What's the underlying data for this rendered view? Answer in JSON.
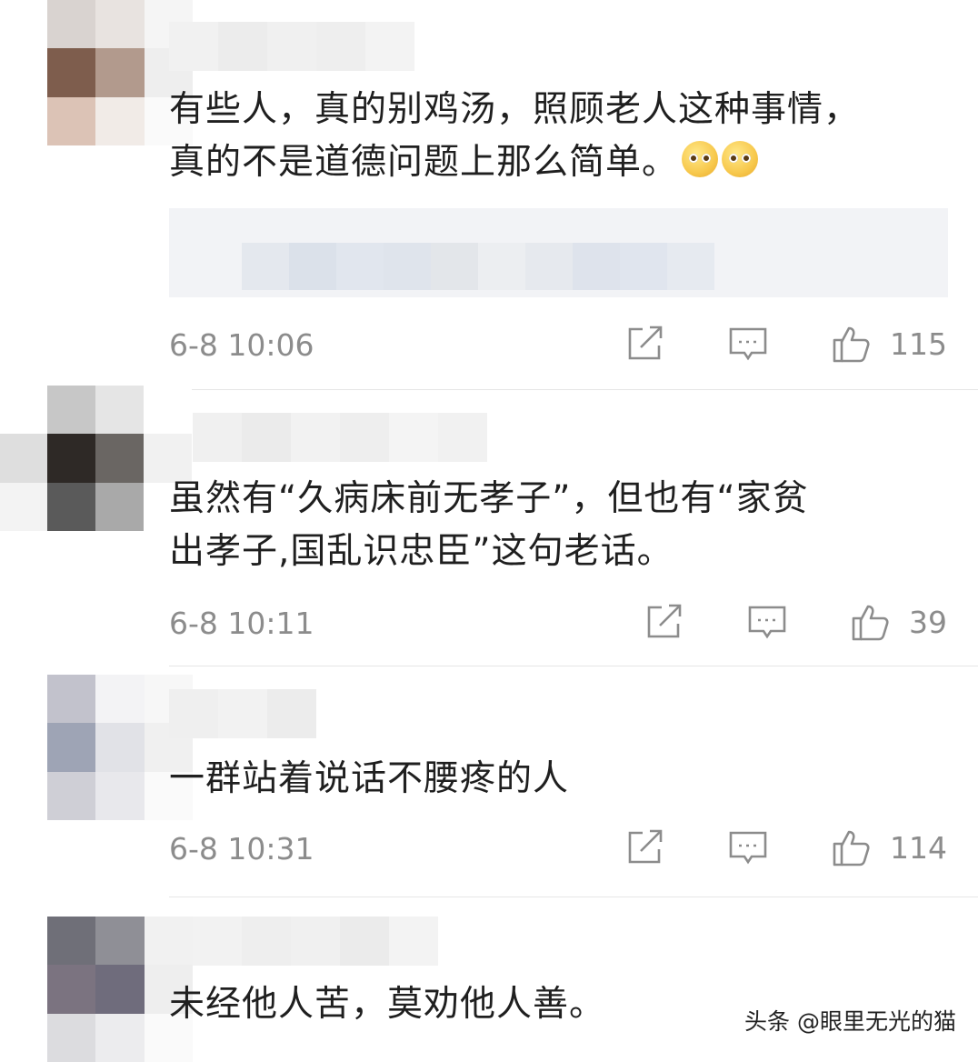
{
  "comments": [
    {
      "text_line1": "有些人，真的别鸡汤，照顾老人这种事情，",
      "text_line2": "真的不是道德问题上那么简单。",
      "emoji": [
        "pleading-face-emoji",
        "pleading-face-emoji"
      ],
      "time": "6-8 10:06",
      "likes": "115"
    },
    {
      "text_line1": "虽然有“久病床前无孝子”，但也有“家贫",
      "text_line2": "出孝子,国乱识忠臣”这句老话。",
      "time": "6-8 10:11",
      "likes": "39"
    },
    {
      "text_line1": "一群站着说话不腰疼的人",
      "time": "6-8 10:31",
      "likes": "114"
    },
    {
      "text_line1": "未经他人苦，莫劝他人善。"
    }
  ],
  "watermark": "头条 @眼里无光的猫",
  "icons": {
    "share": "share-icon",
    "reply": "comment-icon",
    "like": "thumbs-up-icon"
  },
  "colors": {
    "meta_text": "#8c8c8c",
    "quote_bg": "#f2f3f6",
    "divider": "#e6e6e6"
  }
}
